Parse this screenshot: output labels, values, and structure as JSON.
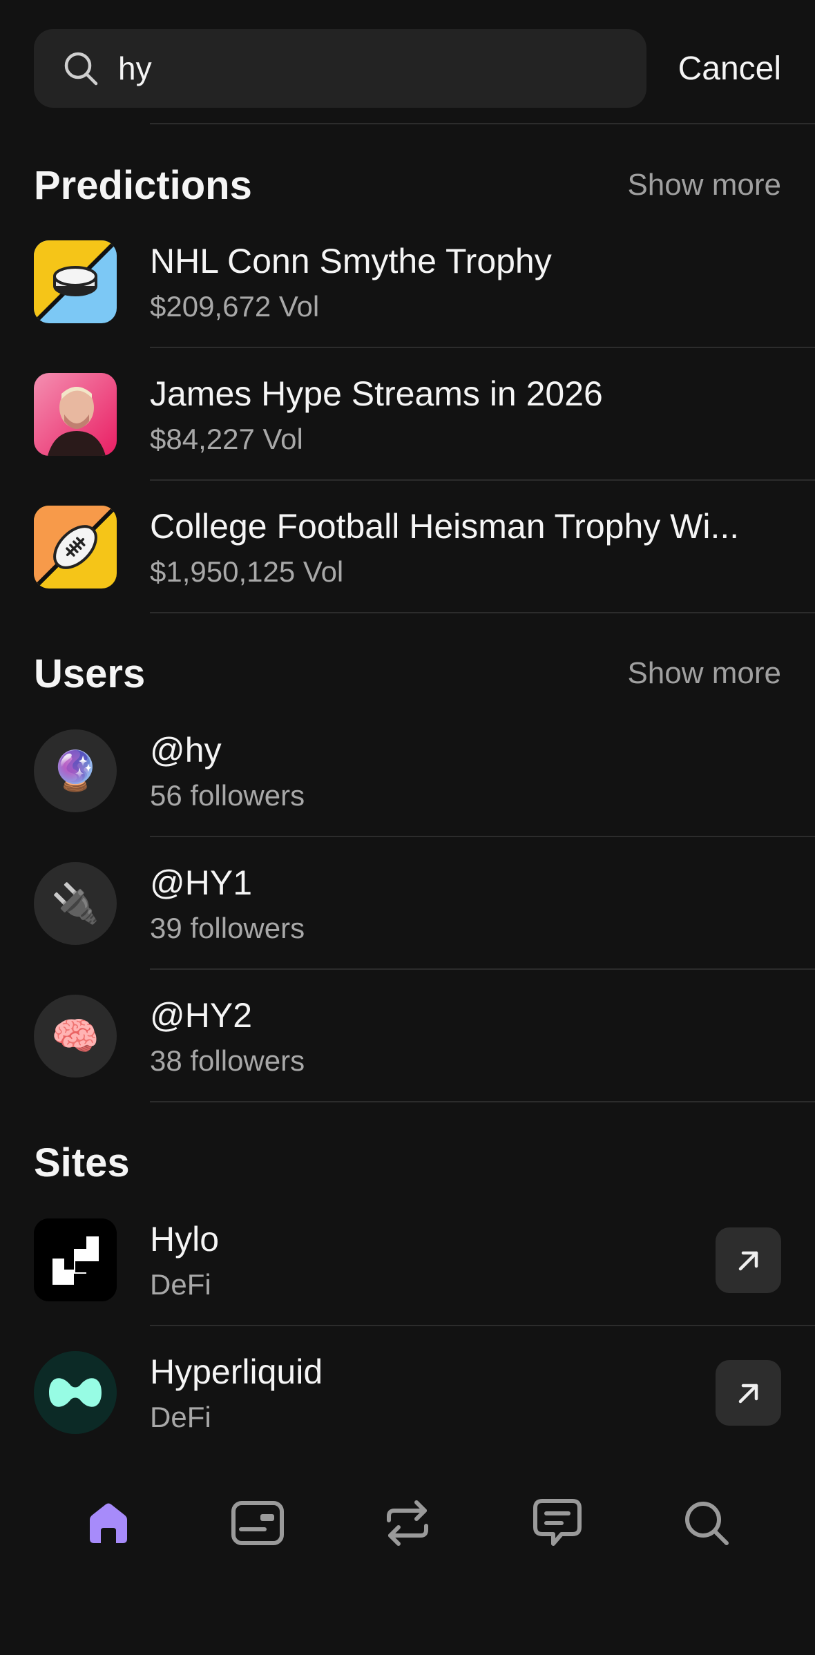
{
  "search": {
    "value": "hy",
    "cancel_label": "Cancel"
  },
  "predictions": {
    "title": "Predictions",
    "show_more": "Show more",
    "items": [
      {
        "title": "NHL Conn Smythe Trophy",
        "volume": "$209,672 Vol",
        "icon": "hockey-puck-icon"
      },
      {
        "title": "James Hype Streams in 2026",
        "volume": "$84,227 Vol",
        "icon": "person-avatar"
      },
      {
        "title": "College Football Heisman Trophy Wi...",
        "volume": "$1,950,125 Vol",
        "icon": "football-icon"
      }
    ]
  },
  "users": {
    "title": "Users",
    "show_more": "Show more",
    "items": [
      {
        "handle": "@hy",
        "followers": "56 followers",
        "emoji": "🔮"
      },
      {
        "handle": "@HY1",
        "followers": "39 followers",
        "emoji": "🔌"
      },
      {
        "handle": "@HY2",
        "followers": "38 followers",
        "emoji": "🧠"
      }
    ]
  },
  "sites": {
    "title": "Sites",
    "items": [
      {
        "name": "Hylo",
        "category": "DeFi",
        "icon": "hylo-logo"
      },
      {
        "name": "Hyperliquid",
        "category": "DeFi",
        "icon": "hyperliquid-logo"
      }
    ]
  },
  "nav": {
    "items": [
      {
        "icon": "home-icon",
        "active": true
      },
      {
        "icon": "wallet-icon",
        "active": false
      },
      {
        "icon": "swap-icon",
        "active": false
      },
      {
        "icon": "chat-icon",
        "active": false
      },
      {
        "icon": "search-icon",
        "active": false
      }
    ]
  },
  "colors": {
    "background": "#121212",
    "accent": "#a78bfa",
    "secondary_text": "#a8a8a8"
  }
}
